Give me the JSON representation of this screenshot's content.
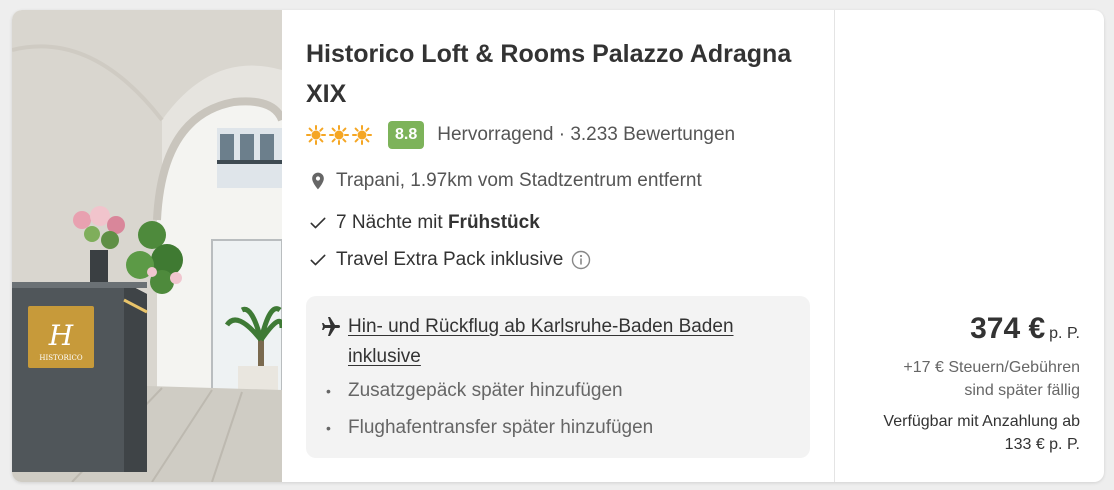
{
  "hotel": {
    "name": "Historico Loft & Rooms Palazzo Adragna XIX",
    "stars": 3,
    "image_sign_text": "HISTORICO",
    "image_sign_monogram": "H"
  },
  "rating": {
    "score": "8.8",
    "label": "Hervorragend",
    "separator": "·",
    "reviews": "3.233 Bewertungen",
    "badge_color": "#7db35a"
  },
  "location": {
    "icon": "location-pin-icon",
    "text": "Trapani, 1.97km vom Stadtzentrum entfernt"
  },
  "features": [
    {
      "icon": "check-icon",
      "prefix": "7 Nächte mit ",
      "bold": "Frühstück"
    },
    {
      "icon": "check-icon",
      "text": "Travel Extra Pack inklusive",
      "info_icon": "info-circle-icon"
    }
  ],
  "flight": {
    "icon": "airplane-icon",
    "text": "Hin- und Rückflug ab Karlsruhe-Baden Baden inklusive",
    "addons": [
      "Zusatzgepäck später hinzufügen",
      "Flughafentransfer später hinzufügen"
    ]
  },
  "price": {
    "amount": "374 €",
    "unit": "p. P.",
    "fees_line1": "+17 € Steuern/Gebühren",
    "fees_line2": "sind später fällig",
    "deposit_line1": "Verfügbar mit Anzahlung ab",
    "deposit_line2": "133 € p. P."
  },
  "colors": {
    "sun_stars": "#f5a623",
    "text_primary": "#333333",
    "text_secondary": "#666666"
  }
}
